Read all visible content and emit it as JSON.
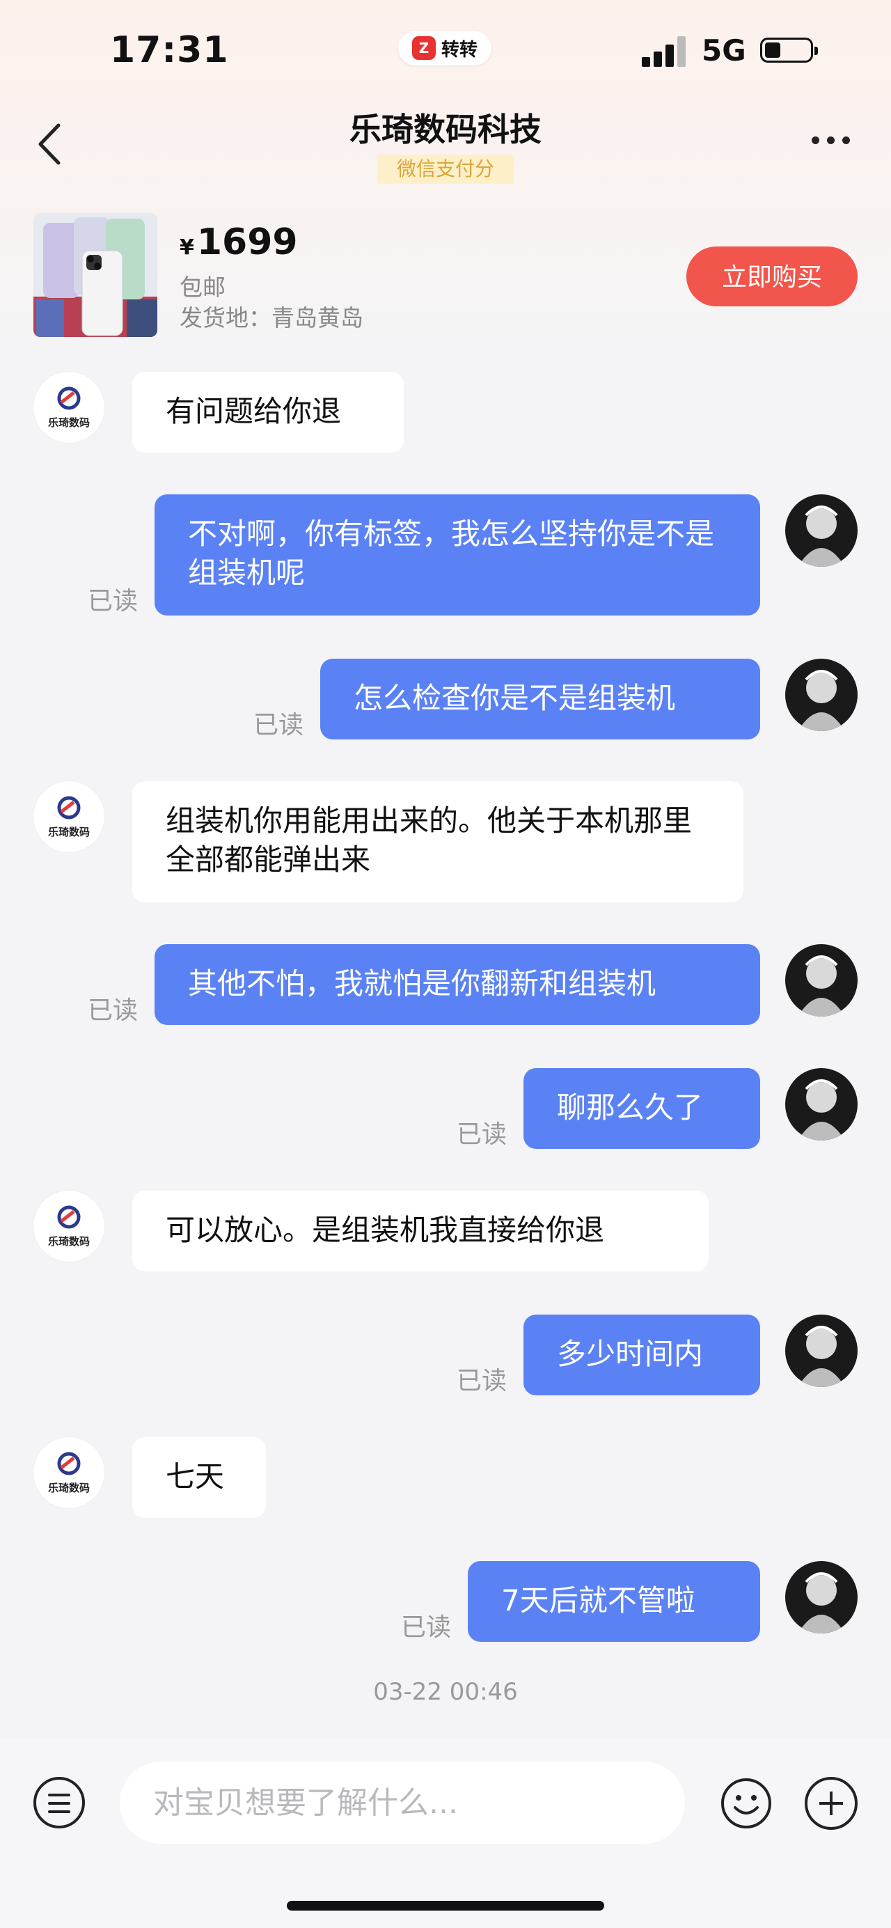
{
  "status_bar": {
    "time": "17:31",
    "app_name": "转转",
    "network": "5G",
    "battery_level": 0.35
  },
  "header": {
    "title": "乐琦数码科技",
    "tag": "微信支付分"
  },
  "product": {
    "currency": "¥",
    "price": "1699",
    "shipping": "包邮",
    "origin": "发货地：青岛黄岛",
    "buy_label": "立即购买"
  },
  "shop_avatar_text": "乐琦数码",
  "messages": [
    {
      "from": "shop",
      "text": "有问题给你退"
    },
    {
      "from": "me",
      "text": "不对啊，你有标签，我怎么坚持你是不是组装机呢",
      "status": "已读"
    },
    {
      "from": "me",
      "text": "怎么检查你是不是组装机",
      "status": "已读"
    },
    {
      "from": "shop",
      "text": "组装机你用能用出来的。他关于本机那里全部都能弹出来"
    },
    {
      "from": "me",
      "text": "其他不怕，我就怕是你翻新和组装机",
      "status": "已读"
    },
    {
      "from": "me",
      "text": "聊那么久了",
      "status": "已读"
    },
    {
      "from": "shop",
      "text": "可以放心。是组装机我直接给你退"
    },
    {
      "from": "me",
      "text": "多少时间内",
      "status": "已读"
    },
    {
      "from": "shop",
      "text": "七天"
    },
    {
      "from": "me",
      "text": "7天后就不管啦",
      "status": "已读"
    }
  ],
  "timestamp": "03-22 00:46",
  "input": {
    "placeholder": "对宝贝想要了解什么..."
  },
  "colors": {
    "accent": "#5b82f5",
    "buy": "#f2554b",
    "tag_bg": "#fdf0c9",
    "tag_text": "#d9a63a"
  },
  "icons": [
    "back-icon",
    "more-icon",
    "menu-icon",
    "emoji-icon",
    "plus-icon"
  ]
}
